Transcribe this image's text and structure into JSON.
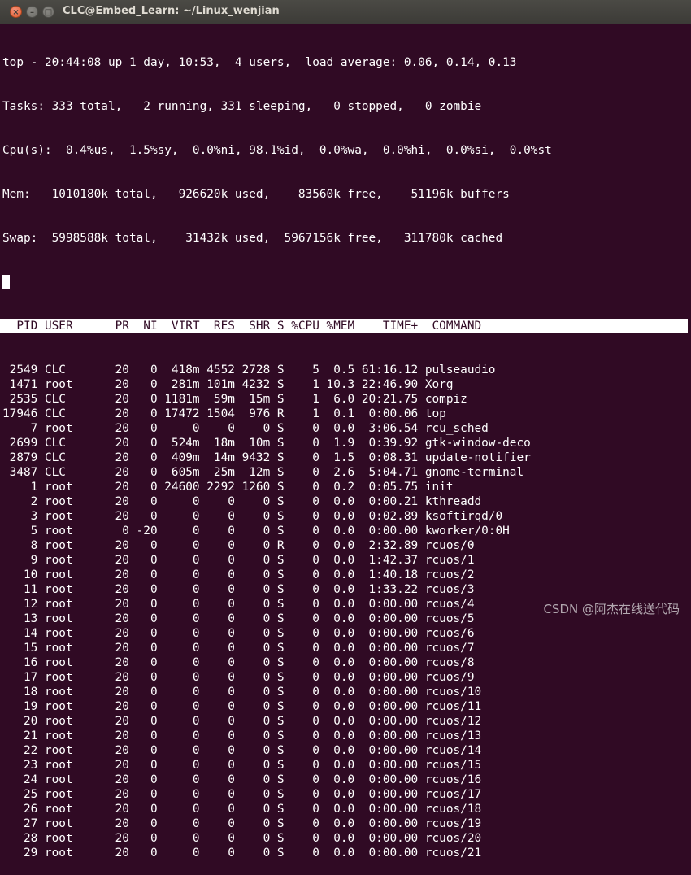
{
  "window": {
    "title": "CLC@Embed_Learn: ~/Linux_wenjian"
  },
  "summary": [
    "top - 20:44:08 up 1 day, 10:53,  4 users,  load average: 0.06, 0.14, 0.13",
    "Tasks: 333 total,   2 running, 331 sleeping,   0 stopped,   0 zombie",
    "Cpu(s):  0.4%us,  1.5%sy,  0.0%ni, 98.1%id,  0.0%wa,  0.0%hi,  0.0%si,  0.0%st",
    "Mem:   1010180k total,   926620k used,    83560k free,    51196k buffers",
    "Swap:  5998588k total,    31432k used,  5967156k free,   311780k cached"
  ],
  "table_header": "  PID USER      PR  NI  VIRT  RES  SHR S %CPU %MEM    TIME+  COMMAND",
  "processes": [
    {
      "pid": "2549",
      "user": "CLC",
      "pr": "20",
      "ni": "0",
      "virt": "418m",
      "res": "4552",
      "shr": "2728",
      "s": "S",
      "cpu": "5",
      "mem": "0.5",
      "time": "61:16.12",
      "command": "pulseaudio"
    },
    {
      "pid": "1471",
      "user": "root",
      "pr": "20",
      "ni": "0",
      "virt": "281m",
      "res": "101m",
      "shr": "4232",
      "s": "S",
      "cpu": "1",
      "mem": "10.3",
      "time": "22:46.90",
      "command": "Xorg"
    },
    {
      "pid": "2535",
      "user": "CLC",
      "pr": "20",
      "ni": "0",
      "virt": "1181m",
      "res": "59m",
      "shr": "15m",
      "s": "S",
      "cpu": "1",
      "mem": "6.0",
      "time": "20:21.75",
      "command": "compiz"
    },
    {
      "pid": "17946",
      "user": "CLC",
      "pr": "20",
      "ni": "0",
      "virt": "17472",
      "res": "1504",
      "shr": "976",
      "s": "R",
      "cpu": "1",
      "mem": "0.1",
      "time": "0:00.06",
      "command": "top"
    },
    {
      "pid": "7",
      "user": "root",
      "pr": "20",
      "ni": "0",
      "virt": "0",
      "res": "0",
      "shr": "0",
      "s": "S",
      "cpu": "0",
      "mem": "0.0",
      "time": "3:06.54",
      "command": "rcu_sched"
    },
    {
      "pid": "2699",
      "user": "CLC",
      "pr": "20",
      "ni": "0",
      "virt": "524m",
      "res": "18m",
      "shr": "10m",
      "s": "S",
      "cpu": "0",
      "mem": "1.9",
      "time": "0:39.92",
      "command": "gtk-window-deco"
    },
    {
      "pid": "2879",
      "user": "CLC",
      "pr": "20",
      "ni": "0",
      "virt": "409m",
      "res": "14m",
      "shr": "9432",
      "s": "S",
      "cpu": "0",
      "mem": "1.5",
      "time": "0:08.31",
      "command": "update-notifier"
    },
    {
      "pid": "3487",
      "user": "CLC",
      "pr": "20",
      "ni": "0",
      "virt": "605m",
      "res": "25m",
      "shr": "12m",
      "s": "S",
      "cpu": "0",
      "mem": "2.6",
      "time": "5:04.71",
      "command": "gnome-terminal"
    },
    {
      "pid": "1",
      "user": "root",
      "pr": "20",
      "ni": "0",
      "virt": "24600",
      "res": "2292",
      "shr": "1260",
      "s": "S",
      "cpu": "0",
      "mem": "0.2",
      "time": "0:05.75",
      "command": "init"
    },
    {
      "pid": "2",
      "user": "root",
      "pr": "20",
      "ni": "0",
      "virt": "0",
      "res": "0",
      "shr": "0",
      "s": "S",
      "cpu": "0",
      "mem": "0.0",
      "time": "0:00.21",
      "command": "kthreadd"
    },
    {
      "pid": "3",
      "user": "root",
      "pr": "20",
      "ni": "0",
      "virt": "0",
      "res": "0",
      "shr": "0",
      "s": "S",
      "cpu": "0",
      "mem": "0.0",
      "time": "0:02.89",
      "command": "ksoftirqd/0"
    },
    {
      "pid": "5",
      "user": "root",
      "pr": "0",
      "ni": "-20",
      "virt": "0",
      "res": "0",
      "shr": "0",
      "s": "S",
      "cpu": "0",
      "mem": "0.0",
      "time": "0:00.00",
      "command": "kworker/0:0H"
    },
    {
      "pid": "8",
      "user": "root",
      "pr": "20",
      "ni": "0",
      "virt": "0",
      "res": "0",
      "shr": "0",
      "s": "R",
      "cpu": "0",
      "mem": "0.0",
      "time": "2:32.89",
      "command": "rcuos/0"
    },
    {
      "pid": "9",
      "user": "root",
      "pr": "20",
      "ni": "0",
      "virt": "0",
      "res": "0",
      "shr": "0",
      "s": "S",
      "cpu": "0",
      "mem": "0.0",
      "time": "1:42.37",
      "command": "rcuos/1"
    },
    {
      "pid": "10",
      "user": "root",
      "pr": "20",
      "ni": "0",
      "virt": "0",
      "res": "0",
      "shr": "0",
      "s": "S",
      "cpu": "0",
      "mem": "0.0",
      "time": "1:40.18",
      "command": "rcuos/2"
    },
    {
      "pid": "11",
      "user": "root",
      "pr": "20",
      "ni": "0",
      "virt": "0",
      "res": "0",
      "shr": "0",
      "s": "S",
      "cpu": "0",
      "mem": "0.0",
      "time": "1:33.22",
      "command": "rcuos/3"
    },
    {
      "pid": "12",
      "user": "root",
      "pr": "20",
      "ni": "0",
      "virt": "0",
      "res": "0",
      "shr": "0",
      "s": "S",
      "cpu": "0",
      "mem": "0.0",
      "time": "0:00.00",
      "command": "rcuos/4"
    },
    {
      "pid": "13",
      "user": "root",
      "pr": "20",
      "ni": "0",
      "virt": "0",
      "res": "0",
      "shr": "0",
      "s": "S",
      "cpu": "0",
      "mem": "0.0",
      "time": "0:00.00",
      "command": "rcuos/5"
    },
    {
      "pid": "14",
      "user": "root",
      "pr": "20",
      "ni": "0",
      "virt": "0",
      "res": "0",
      "shr": "0",
      "s": "S",
      "cpu": "0",
      "mem": "0.0",
      "time": "0:00.00",
      "command": "rcuos/6"
    },
    {
      "pid": "15",
      "user": "root",
      "pr": "20",
      "ni": "0",
      "virt": "0",
      "res": "0",
      "shr": "0",
      "s": "S",
      "cpu": "0",
      "mem": "0.0",
      "time": "0:00.00",
      "command": "rcuos/7"
    },
    {
      "pid": "16",
      "user": "root",
      "pr": "20",
      "ni": "0",
      "virt": "0",
      "res": "0",
      "shr": "0",
      "s": "S",
      "cpu": "0",
      "mem": "0.0",
      "time": "0:00.00",
      "command": "rcuos/8"
    },
    {
      "pid": "17",
      "user": "root",
      "pr": "20",
      "ni": "0",
      "virt": "0",
      "res": "0",
      "shr": "0",
      "s": "S",
      "cpu": "0",
      "mem": "0.0",
      "time": "0:00.00",
      "command": "rcuos/9"
    },
    {
      "pid": "18",
      "user": "root",
      "pr": "20",
      "ni": "0",
      "virt": "0",
      "res": "0",
      "shr": "0",
      "s": "S",
      "cpu": "0",
      "mem": "0.0",
      "time": "0:00.00",
      "command": "rcuos/10"
    },
    {
      "pid": "19",
      "user": "root",
      "pr": "20",
      "ni": "0",
      "virt": "0",
      "res": "0",
      "shr": "0",
      "s": "S",
      "cpu": "0",
      "mem": "0.0",
      "time": "0:00.00",
      "command": "rcuos/11"
    },
    {
      "pid": "20",
      "user": "root",
      "pr": "20",
      "ni": "0",
      "virt": "0",
      "res": "0",
      "shr": "0",
      "s": "S",
      "cpu": "0",
      "mem": "0.0",
      "time": "0:00.00",
      "command": "rcuos/12"
    },
    {
      "pid": "21",
      "user": "root",
      "pr": "20",
      "ni": "0",
      "virt": "0",
      "res": "0",
      "shr": "0",
      "s": "S",
      "cpu": "0",
      "mem": "0.0",
      "time": "0:00.00",
      "command": "rcuos/13"
    },
    {
      "pid": "22",
      "user": "root",
      "pr": "20",
      "ni": "0",
      "virt": "0",
      "res": "0",
      "shr": "0",
      "s": "S",
      "cpu": "0",
      "mem": "0.0",
      "time": "0:00.00",
      "command": "rcuos/14"
    },
    {
      "pid": "23",
      "user": "root",
      "pr": "20",
      "ni": "0",
      "virt": "0",
      "res": "0",
      "shr": "0",
      "s": "S",
      "cpu": "0",
      "mem": "0.0",
      "time": "0:00.00",
      "command": "rcuos/15"
    },
    {
      "pid": "24",
      "user": "root",
      "pr": "20",
      "ni": "0",
      "virt": "0",
      "res": "0",
      "shr": "0",
      "s": "S",
      "cpu": "0",
      "mem": "0.0",
      "time": "0:00.00",
      "command": "rcuos/16"
    },
    {
      "pid": "25",
      "user": "root",
      "pr": "20",
      "ni": "0",
      "virt": "0",
      "res": "0",
      "shr": "0",
      "s": "S",
      "cpu": "0",
      "mem": "0.0",
      "time": "0:00.00",
      "command": "rcuos/17"
    },
    {
      "pid": "26",
      "user": "root",
      "pr": "20",
      "ni": "0",
      "virt": "0",
      "res": "0",
      "shr": "0",
      "s": "S",
      "cpu": "0",
      "mem": "0.0",
      "time": "0:00.00",
      "command": "rcuos/18"
    },
    {
      "pid": "27",
      "user": "root",
      "pr": "20",
      "ni": "0",
      "virt": "0",
      "res": "0",
      "shr": "0",
      "s": "S",
      "cpu": "0",
      "mem": "0.0",
      "time": "0:00.00",
      "command": "rcuos/19"
    },
    {
      "pid": "28",
      "user": "root",
      "pr": "20",
      "ni": "0",
      "virt": "0",
      "res": "0",
      "shr": "0",
      "s": "S",
      "cpu": "0",
      "mem": "0.0",
      "time": "0:00.00",
      "command": "rcuos/20"
    },
    {
      "pid": "29",
      "user": "root",
      "pr": "20",
      "ni": "0",
      "virt": "0",
      "res": "0",
      "shr": "0",
      "s": "S",
      "cpu": "0",
      "mem": "0.0",
      "time": "0:00.00",
      "command": "rcuos/21"
    }
  ],
  "watermark": "CSDN @阿杰在线送代码",
  "colors": {
    "terminal_bg": "#300a24",
    "terminal_fg": "#ffffff",
    "titlebar_bg": "#3c3b37",
    "close_button": "#e05a2b"
  }
}
